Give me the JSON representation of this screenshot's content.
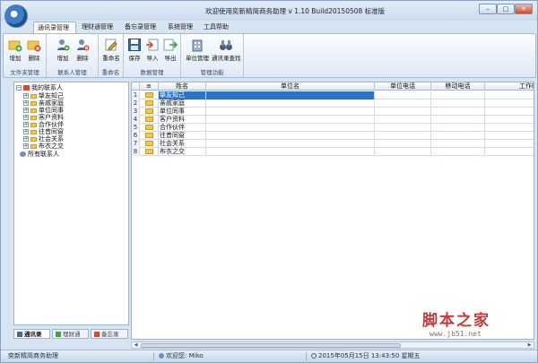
{
  "window": {
    "title": "欢迎使用奕新精简商务助理 v 1.10 Build20150508 标准版",
    "min_label": "–",
    "max_label": "□",
    "close_label": "✕"
  },
  "ribbon_tabs": [
    "通讯录管理",
    "理财通管理",
    "备忘录管理",
    "系统管理",
    "工具帮助"
  ],
  "ribbon_groups": [
    {
      "label": "文件夹管理",
      "buttons": [
        "增加",
        "删除"
      ]
    },
    {
      "label": "联系人管理",
      "buttons": [
        "增加",
        "删除"
      ]
    },
    {
      "label": "重命名",
      "buttons": [
        "重命名"
      ]
    },
    {
      "label": "数据管理",
      "buttons": [
        "保存",
        "导入",
        "导出"
      ]
    },
    {
      "label": "管理功能",
      "buttons": [
        "单位管理",
        "通讯录查找"
      ]
    }
  ],
  "tree": {
    "root": "我的联系人",
    "children": [
      "挚友知己",
      "亲戚家庭",
      "单位同事",
      "客户资料",
      "合作伙伴",
      "往昔同窗",
      "社会关系",
      "布衣之交"
    ],
    "all_contacts": "所有联系人"
  },
  "bottom_tabs": [
    "通讯录",
    "理财通",
    "备忘录"
  ],
  "grid": {
    "headers": [
      "",
      "姓名",
      "单位名",
      "单位电话",
      "移动电话",
      "工作邮箱"
    ],
    "rows": [
      {
        "num": "1",
        "name": "挚友知己",
        "selected": true
      },
      {
        "num": "2",
        "name": "亲戚家庭",
        "selected": false
      },
      {
        "num": "3",
        "name": "单位同事",
        "selected": false
      },
      {
        "num": "4",
        "name": "客户资料",
        "selected": false
      },
      {
        "num": "5",
        "name": "合作伙伴",
        "selected": false
      },
      {
        "num": "6",
        "name": "往昔同窗",
        "selected": false
      },
      {
        "num": "7",
        "name": "社会关系",
        "selected": false
      },
      {
        "num": "8",
        "name": "布衣之交",
        "selected": false
      }
    ],
    "icon_header": "≡",
    "scroll_left": "◀",
    "scroll_right": "▶"
  },
  "status": {
    "app": "奕新精简商务助理",
    "welcome": "欢迎您: Miko",
    "datetime": "2015年05月15日 13:43:50 星期五"
  },
  "watermark": {
    "main": "脚本之家",
    "url": "www.jb51.net"
  },
  "colors": {
    "selection": "#2f73c8",
    "folder": "#f3c552",
    "accent_red": "#d9472d"
  }
}
